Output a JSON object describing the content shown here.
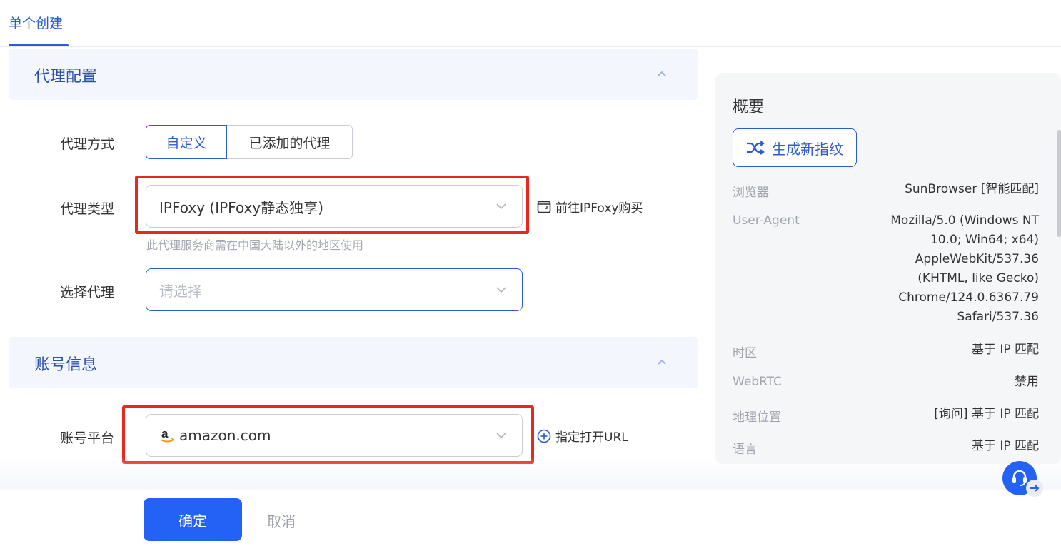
{
  "tabs": {
    "active": "单个创建"
  },
  "proxy_section": {
    "title": "代理配置",
    "method_label": "代理方式",
    "method_options": [
      "自定义",
      "已添加的代理"
    ],
    "type_label": "代理类型",
    "type_value": "IPFoxy (IPFoxy静态独享)",
    "buy_link": "前往IPFoxy购买",
    "hint": "此代理服务商需在中国大陆以外的地区使用",
    "select_label": "选择代理",
    "select_placeholder": "请选择"
  },
  "account_section": {
    "title": "账号信息",
    "platform_label": "账号平台",
    "platform_value": "amazon.com",
    "url_link": "指定打开URL"
  },
  "summary": {
    "title": "概要",
    "fingerprint_button": "生成新指纹",
    "rows": [
      {
        "key": "浏览器",
        "value": "SunBrowser [智能匹配]"
      },
      {
        "key": "User-Agent",
        "value_lines": [
          "Mozilla/5.0 (Windows NT",
          "10.0; Win64; x64)",
          "AppleWebKit/537.36",
          "(KHTML, like Gecko)",
          "Chrome/124.0.6367.79",
          "Safari/537.36"
        ]
      },
      {
        "key": "时区",
        "value": "基于 IP 匹配"
      },
      {
        "key": "WebRTC",
        "value": "禁用"
      },
      {
        "key": "地理位置",
        "value": "[询问] 基于 IP 匹配"
      },
      {
        "key": "语言",
        "value": "基于 IP 匹配"
      }
    ]
  },
  "footer": {
    "ok": "确定",
    "cancel": "取消"
  },
  "colors": {
    "primary": "#2462f5",
    "accent_text": "#2c5bd8",
    "highlight": "#e8271f"
  }
}
